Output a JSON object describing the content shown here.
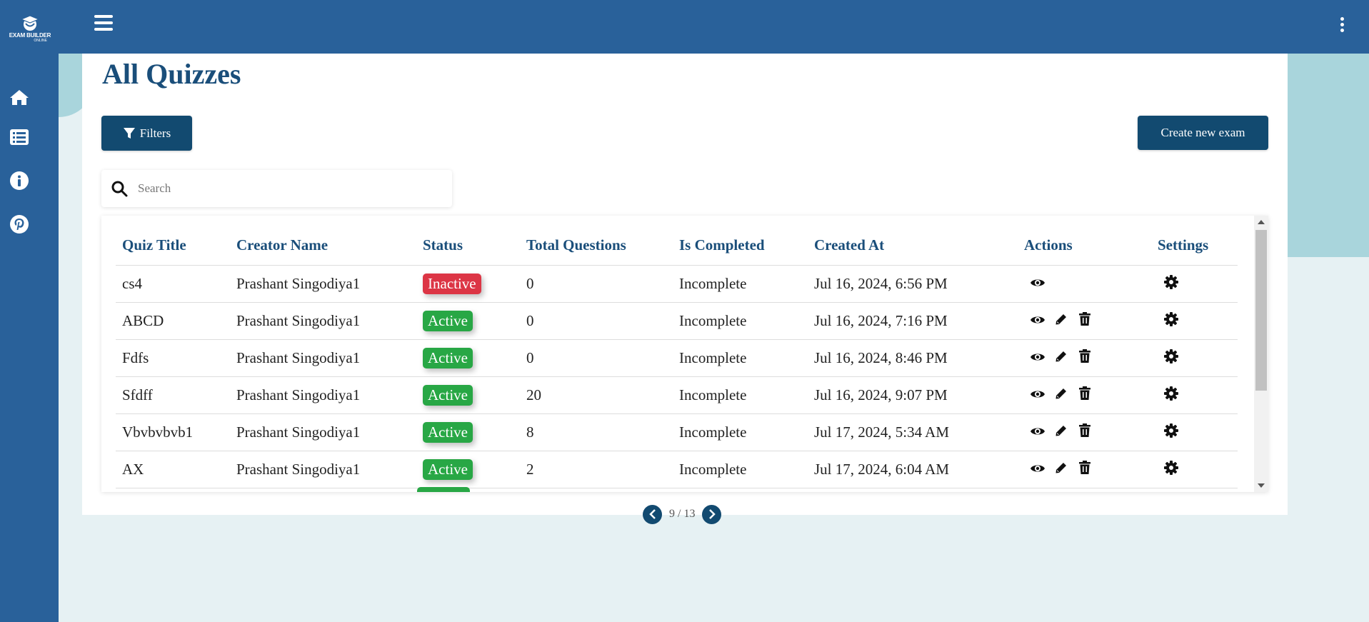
{
  "app": {
    "logo_text": "EXAM BUILDER",
    "logo_sub": "ONLINE"
  },
  "sidebar": {
    "items": [
      {
        "icon": "home-icon"
      },
      {
        "icon": "list-icon"
      },
      {
        "icon": "info-icon"
      },
      {
        "icon": "pinterest-icon"
      }
    ]
  },
  "main": {
    "title": "All Quizzes",
    "filters_label": "Filters",
    "create_label": "Create new exam",
    "search_placeholder": "Search"
  },
  "table": {
    "headers": [
      "Quiz Title",
      "Creator Name",
      "Status",
      "Total Questions",
      "Is Completed",
      "Created At",
      "Actions",
      "Settings"
    ],
    "rows": [
      {
        "title": "cs4",
        "creator": "Prashant Singodiya1",
        "status": "Inactive",
        "total": "0",
        "completed": "Incomplete",
        "created": "Jul 16, 2024, 6:56 PM"
      },
      {
        "title": "ABCD",
        "creator": "Prashant Singodiya1",
        "status": "Active",
        "total": "0",
        "completed": "Incomplete",
        "created": "Jul 16, 2024, 7:16 PM"
      },
      {
        "title": "Fdfs",
        "creator": "Prashant Singodiya1",
        "status": "Active",
        "total": "0",
        "completed": "Incomplete",
        "created": "Jul 16, 2024, 8:46 PM"
      },
      {
        "title": "Sfdff",
        "creator": "Prashant Singodiya1",
        "status": "Active",
        "total": "20",
        "completed": "Incomplete",
        "created": "Jul 16, 2024, 9:07 PM"
      },
      {
        "title": "Vbvbvbvb1",
        "creator": "Prashant Singodiya1",
        "status": "Active",
        "total": "8",
        "completed": "Incomplete",
        "created": "Jul 17, 2024, 5:34 AM"
      },
      {
        "title": "AX",
        "creator": "Prashant Singodiya1",
        "status": "Active",
        "total": "2",
        "completed": "Incomplete",
        "created": "Jul 17, 2024, 6:04 AM"
      }
    ]
  },
  "pagination": {
    "text": "9 / 13"
  },
  "colors": {
    "primary": "#29619a",
    "button": "#124a70",
    "heading": "#1a4e7a",
    "active": "#28a745",
    "inactive": "#dc3545",
    "background": "#e6f1f3"
  }
}
